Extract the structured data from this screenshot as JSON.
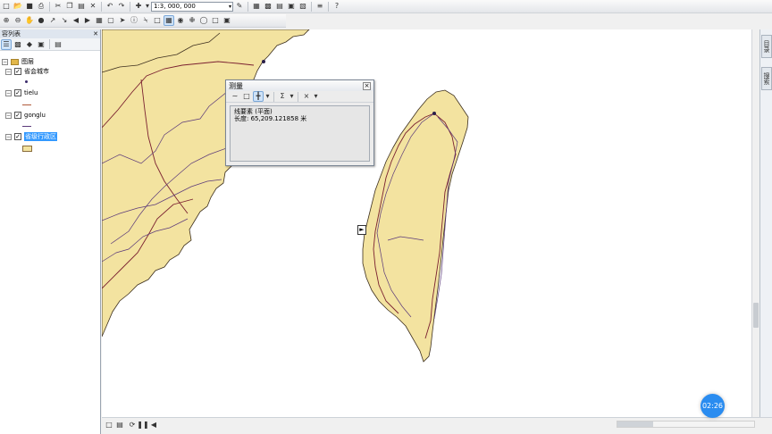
{
  "toolbar": {
    "scale_value": "1:3, 000, 000",
    "scale_dropdown_icon": "chevron-down-icon"
  },
  "toc": {
    "title": "容列表",
    "pin_label": "✕",
    "layers_root": "图层",
    "layers": [
      {
        "name": "省会城市",
        "checked": "✓",
        "symbol": "point"
      },
      {
        "name": "tielu",
        "checked": "✓",
        "symbol": "line-red"
      },
      {
        "name": "gonglu",
        "checked": "✓",
        "symbol": "line-blue"
      },
      {
        "name": "省级行政区",
        "checked": "✓",
        "symbol": "polygon"
      }
    ]
  },
  "measure_dialog": {
    "title": "测量",
    "close_label": "×",
    "sigma_label": "Σ",
    "x_label": "×",
    "line1": "线要素 (平面)",
    "line2": "长度: 65,209.121858 米"
  },
  "right_dock": {
    "tab1": "目录",
    "tab2": "搜索"
  },
  "timer": {
    "value": "02:26"
  },
  "colors": {
    "land_fill": "#f3e3a0",
    "boundary": "#3d2f1e",
    "railway": "#7a2030",
    "highway": "#5b3a7a",
    "accent": "#2a8cf0",
    "selection": "#3399ff"
  }
}
